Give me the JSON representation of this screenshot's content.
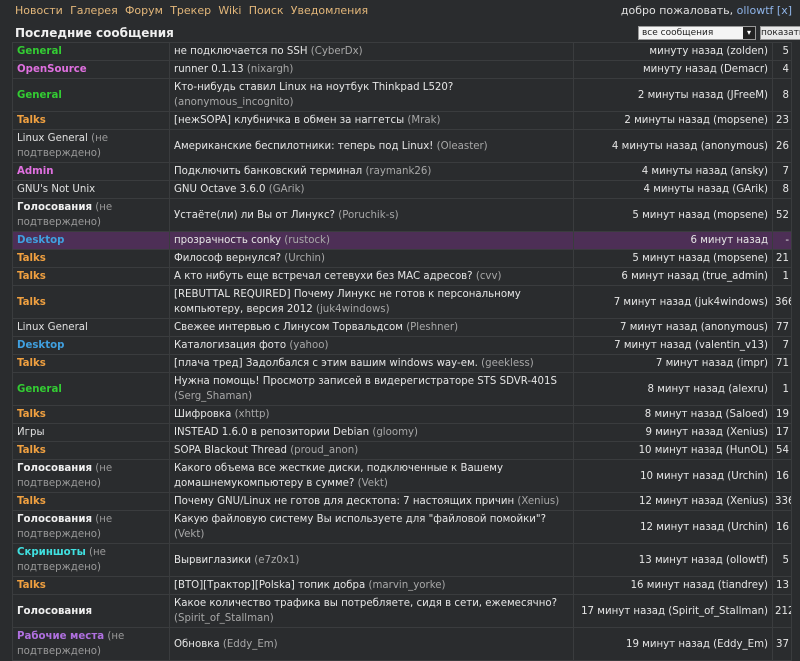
{
  "nav": [
    "Новости",
    "Галерея",
    "Форум",
    "Трекер",
    "Wiki",
    "Поиск",
    "Уведомления"
  ],
  "welcome": {
    "prefix": "добро пожаловать,",
    "user": "ollowtf",
    "close": "[x]"
  },
  "header": {
    "title": "Последние сообщения",
    "filter_value": "все сообщения",
    "show_button": "показать"
  },
  "colors": {
    "General": "#33cc33",
    "OpenSource": "#e070e0",
    "Talks": "#f0a040",
    "Admin": "#e070e0",
    "Desktop": "#40a0e0",
    "Скриншоты": "#40e0e0",
    "Рабочие места": "#b070e0",
    "Голосования": "#f0f0f0"
  },
  "rows": [
    {
      "cat": "General",
      "color": "#33cc33",
      "bold": true,
      "note": "",
      "topic": "не подключается по SSH",
      "author": "(CyberDx)",
      "time": "минуту назад (zolden)",
      "count": "5"
    },
    {
      "cat": "OpenSource",
      "color": "#e070e0",
      "bold": true,
      "note": "",
      "topic": "runner 0.1.13",
      "author": "(nixargh)",
      "time": "минуту назад (Demacr)",
      "count": "4"
    },
    {
      "cat": "General",
      "color": "#33cc33",
      "bold": true,
      "note": "",
      "topic": "Кто-нибудь ставил Linux на ноутбук Thinkpad L520?",
      "author": "(anonymous_incognito)",
      "time": "2 минуты назад (JFreeM)",
      "count": "8"
    },
    {
      "cat": "Talks",
      "color": "#f0a040",
      "bold": true,
      "note": "",
      "topic": "[нежSOPA] клубничка в обмен за наггетсы",
      "author": "(Mrak)",
      "time": "2 минуты назад (mopsene)",
      "count": "23"
    },
    {
      "cat": "Linux General",
      "color": "#e0e0e0",
      "bold": false,
      "note": "(не подтверждено)",
      "topic": "Американские беспилотники: теперь под Linux!",
      "author": "(Oleaster)",
      "time": "4 минуты назад (anonymous)",
      "count": "26"
    },
    {
      "cat": "Admin",
      "color": "#e070e0",
      "bold": true,
      "note": "",
      "topic": "Подключить банковский терминал",
      "author": "(raymank26)",
      "time": "4 минуты назад (ansky)",
      "count": "7"
    },
    {
      "cat": "GNU's Not Unix",
      "color": "#e0e0e0",
      "bold": false,
      "note": "",
      "topic": "GNU Octave 3.6.0",
      "author": "(GArik)",
      "time": "4 минуты назад (GArik)",
      "count": "8"
    },
    {
      "cat": "Голосования",
      "color": "#f0f0f0",
      "bold": true,
      "note": "(не подтверждено)",
      "topic": "Устаёте(ли) ли Вы от Линукс?",
      "author": "(Poruchik-s)",
      "time": "5 минут назад (mopsene)",
      "count": "52"
    },
    {
      "cat": "Desktop",
      "color": "#40a0e0",
      "bold": true,
      "note": "",
      "topic": "прозрачность conky",
      "author": "(rustock)",
      "time": "6 минут назад",
      "count": "-",
      "hl": true
    },
    {
      "cat": "Talks",
      "color": "#f0a040",
      "bold": true,
      "note": "",
      "topic": "Философ вернулся?",
      "author": "(Urchin)",
      "time": "5 минут назад (mopsene)",
      "count": "21"
    },
    {
      "cat": "Talks",
      "color": "#f0a040",
      "bold": true,
      "note": "",
      "topic": "А кто нибуть еще встречал сетевухи без MAC адресов?",
      "author": "(cvv)",
      "time": "6 минут назад (true_admin)",
      "count": "1"
    },
    {
      "cat": "Talks",
      "color": "#f0a040",
      "bold": true,
      "note": "",
      "topic": "[REBUTTAL REQUIRED] Почему Линукс не готов к персональному компьютеру, версия 2012",
      "author": "(juk4windows)",
      "time": "7 минут назад (juk4windows)",
      "count": "366"
    },
    {
      "cat": "Linux General",
      "color": "#e0e0e0",
      "bold": false,
      "note": "",
      "topic": "Свежее интервью с Линусом Торвальдсом",
      "author": "(Pleshner)",
      "time": "7 минут назад (anonymous)",
      "count": "77"
    },
    {
      "cat": "Desktop",
      "color": "#40a0e0",
      "bold": true,
      "note": "",
      "topic": "Каталогизация фото",
      "author": "(yahoo)",
      "time": "7 минут назад (valentin_v13)",
      "count": "7"
    },
    {
      "cat": "Talks",
      "color": "#f0a040",
      "bold": true,
      "note": "",
      "topic": "[плача тред] Задолбался с этим вашим windows way-ем.",
      "author": "(geekless)",
      "time": "7 минут назад (impr)",
      "count": "71"
    },
    {
      "cat": "General",
      "color": "#33cc33",
      "bold": true,
      "note": "",
      "topic": "Нужна помощь! Просмотр записей в видерегистраторе STS SDVR-401S",
      "author": "(Serg_Shaman)",
      "time": "8 минут назад (alexru)",
      "count": "1"
    },
    {
      "cat": "Talks",
      "color": "#f0a040",
      "bold": true,
      "note": "",
      "topic": "Шифровка",
      "author": "(xhttp)",
      "time": "8 минут назад (Saloed)",
      "count": "19"
    },
    {
      "cat": "Игры",
      "color": "#e0e0e0",
      "bold": false,
      "note": "",
      "topic": "INSTEAD 1.6.0 в репозитории Debian",
      "author": "(gloomy)",
      "time": "9 минут назад (Xenius)",
      "count": "17"
    },
    {
      "cat": "Talks",
      "color": "#f0a040",
      "bold": true,
      "note": "",
      "topic": "SOPA Blackout Thread",
      "author": "(proud_anon)",
      "time": "10 минут назад (HunOL)",
      "count": "54"
    },
    {
      "cat": "Голосования",
      "color": "#f0f0f0",
      "bold": true,
      "note": "(не подтверждено)",
      "topic": "Какого объема все жесткие диски, подключенные к Вашему домашнемукомпьютеру в сумме?",
      "author": "(Vekt)",
      "time": "10 минут назад (Urchin)",
      "count": "16"
    },
    {
      "cat": "Talks",
      "color": "#f0a040",
      "bold": true,
      "note": "",
      "topic": "Почему GNU/Linux не готов для десктопа: 7 настоящих причин",
      "author": "(Xenius)",
      "time": "12 минут назад (Xenius)",
      "count": "336"
    },
    {
      "cat": "Голосования",
      "color": "#f0f0f0",
      "bold": true,
      "note": "(не подтверждено)",
      "topic": "Какую файловую систему Вы используете для \"файловой помойки\"?",
      "author": "(Vekt)",
      "time": "12 минут назад (Urchin)",
      "count": "16"
    },
    {
      "cat": "Скриншоты",
      "color": "#40e0e0",
      "bold": true,
      "note": "(не подтверждено)",
      "topic": "Вырвиглазики",
      "author": "(e7z0x1)",
      "time": "13 минут назад (ollowtf)",
      "count": "5"
    },
    {
      "cat": "Talks",
      "color": "#f0a040",
      "bold": true,
      "note": "",
      "topic": "[ВТО][Трактор][Polska] топик добра",
      "author": "(marvin_yorke)",
      "time": "16 минут назад (tiandrey)",
      "count": "13"
    },
    {
      "cat": "Голосования",
      "color": "#f0f0f0",
      "bold": true,
      "note": "",
      "topic": "Какое количество трафика вы потребляете, сидя в сети, ежемесячно?",
      "author": "(Spirit_of_Stallman)",
      "time": "17 минут назад (Spirit_of_Stallman)",
      "count": "212"
    },
    {
      "cat": "Рабочие места",
      "color": "#b070e0",
      "bold": true,
      "note": "(не подтверждено)",
      "topic": "Обновка",
      "author": "(Eddy_Em)",
      "time": "19 минут назад (Eddy_Em)",
      "count": "37"
    }
  ]
}
